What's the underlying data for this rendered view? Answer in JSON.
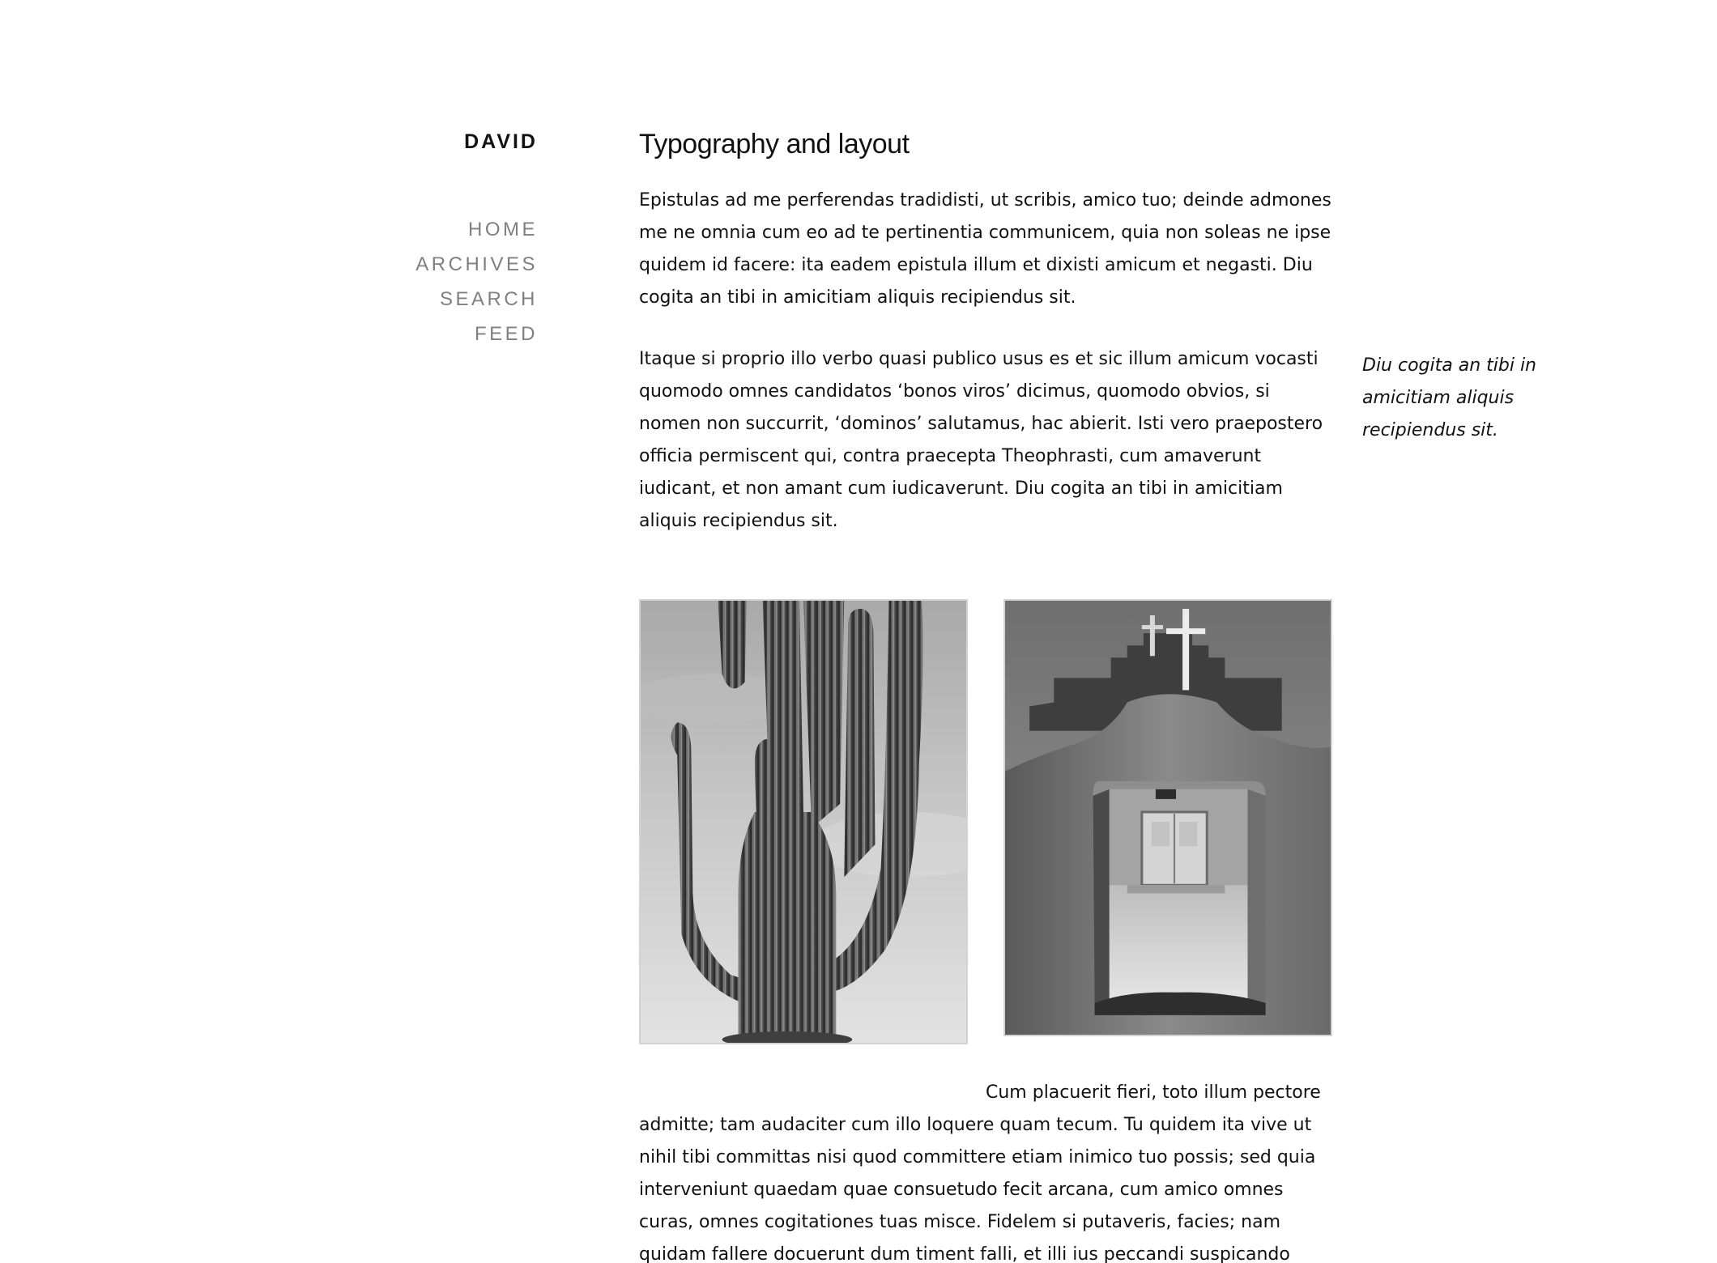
{
  "site": {
    "name": "DAVID"
  },
  "nav": {
    "items": [
      {
        "label": "HOME"
      },
      {
        "label": "ARCHIVES"
      },
      {
        "label": "SEARCH"
      },
      {
        "label": "FEED"
      }
    ]
  },
  "article": {
    "title": "Typography and layout",
    "paragraphs": [
      "Epistulas ad me perferendas tradidisti, ut scribis, amico tuo; deinde admones me ne omnia cum eo ad te pertinentia communicem, quia non soleas ne ipse quidem id facere: ita eadem epistula illum et dixisti amicum et negasti. Diu cogita an tibi in amicitiam aliquis recipiendus sit.",
      "Itaque si proprio illo verbo quasi publico usus es et sic illum amicum vocasti quomodo omnes candidatos ‘bonos viros’ dicimus, quomodo obvios, si nomen non succurrit, ‘dominos’ salutamus, hac abierit. Isti vero praepostero officia permiscent qui, contra praecepta Theophrasti, cum amaverunt iudicant, et non amant cum iudicaverunt. Diu cogita an tibi in amicitiam aliquis recipiendus sit.",
      "Cum placuerit fieri, toto illum pectore admitte; tam audaciter cum illo loquere quam tecum. Tu quidem ita vive ut nihil tibi committas nisi quod committere etiam inimico tuo possis; sed quia interveniunt quaedam quae consuetudo fecit arcana, cum amico omnes curas, omnes cogitationes tuas misce. Fidelem si putaveris, facies; nam quidam fallere docuerunt dum timent falli, et illi ius peccandi suspicando"
    ],
    "sidenote": "Diu cogita an tibi in amicitiam aliquis recipiendus sit.",
    "figures": [
      {
        "subject": "saguaro-cactus-photo"
      },
      {
        "subject": "mission-gate-photo"
      }
    ]
  },
  "colors": {
    "text": "#111111",
    "nav_text": "#808080",
    "image_border": "#d3d3d3",
    "background": "#ffffff"
  }
}
